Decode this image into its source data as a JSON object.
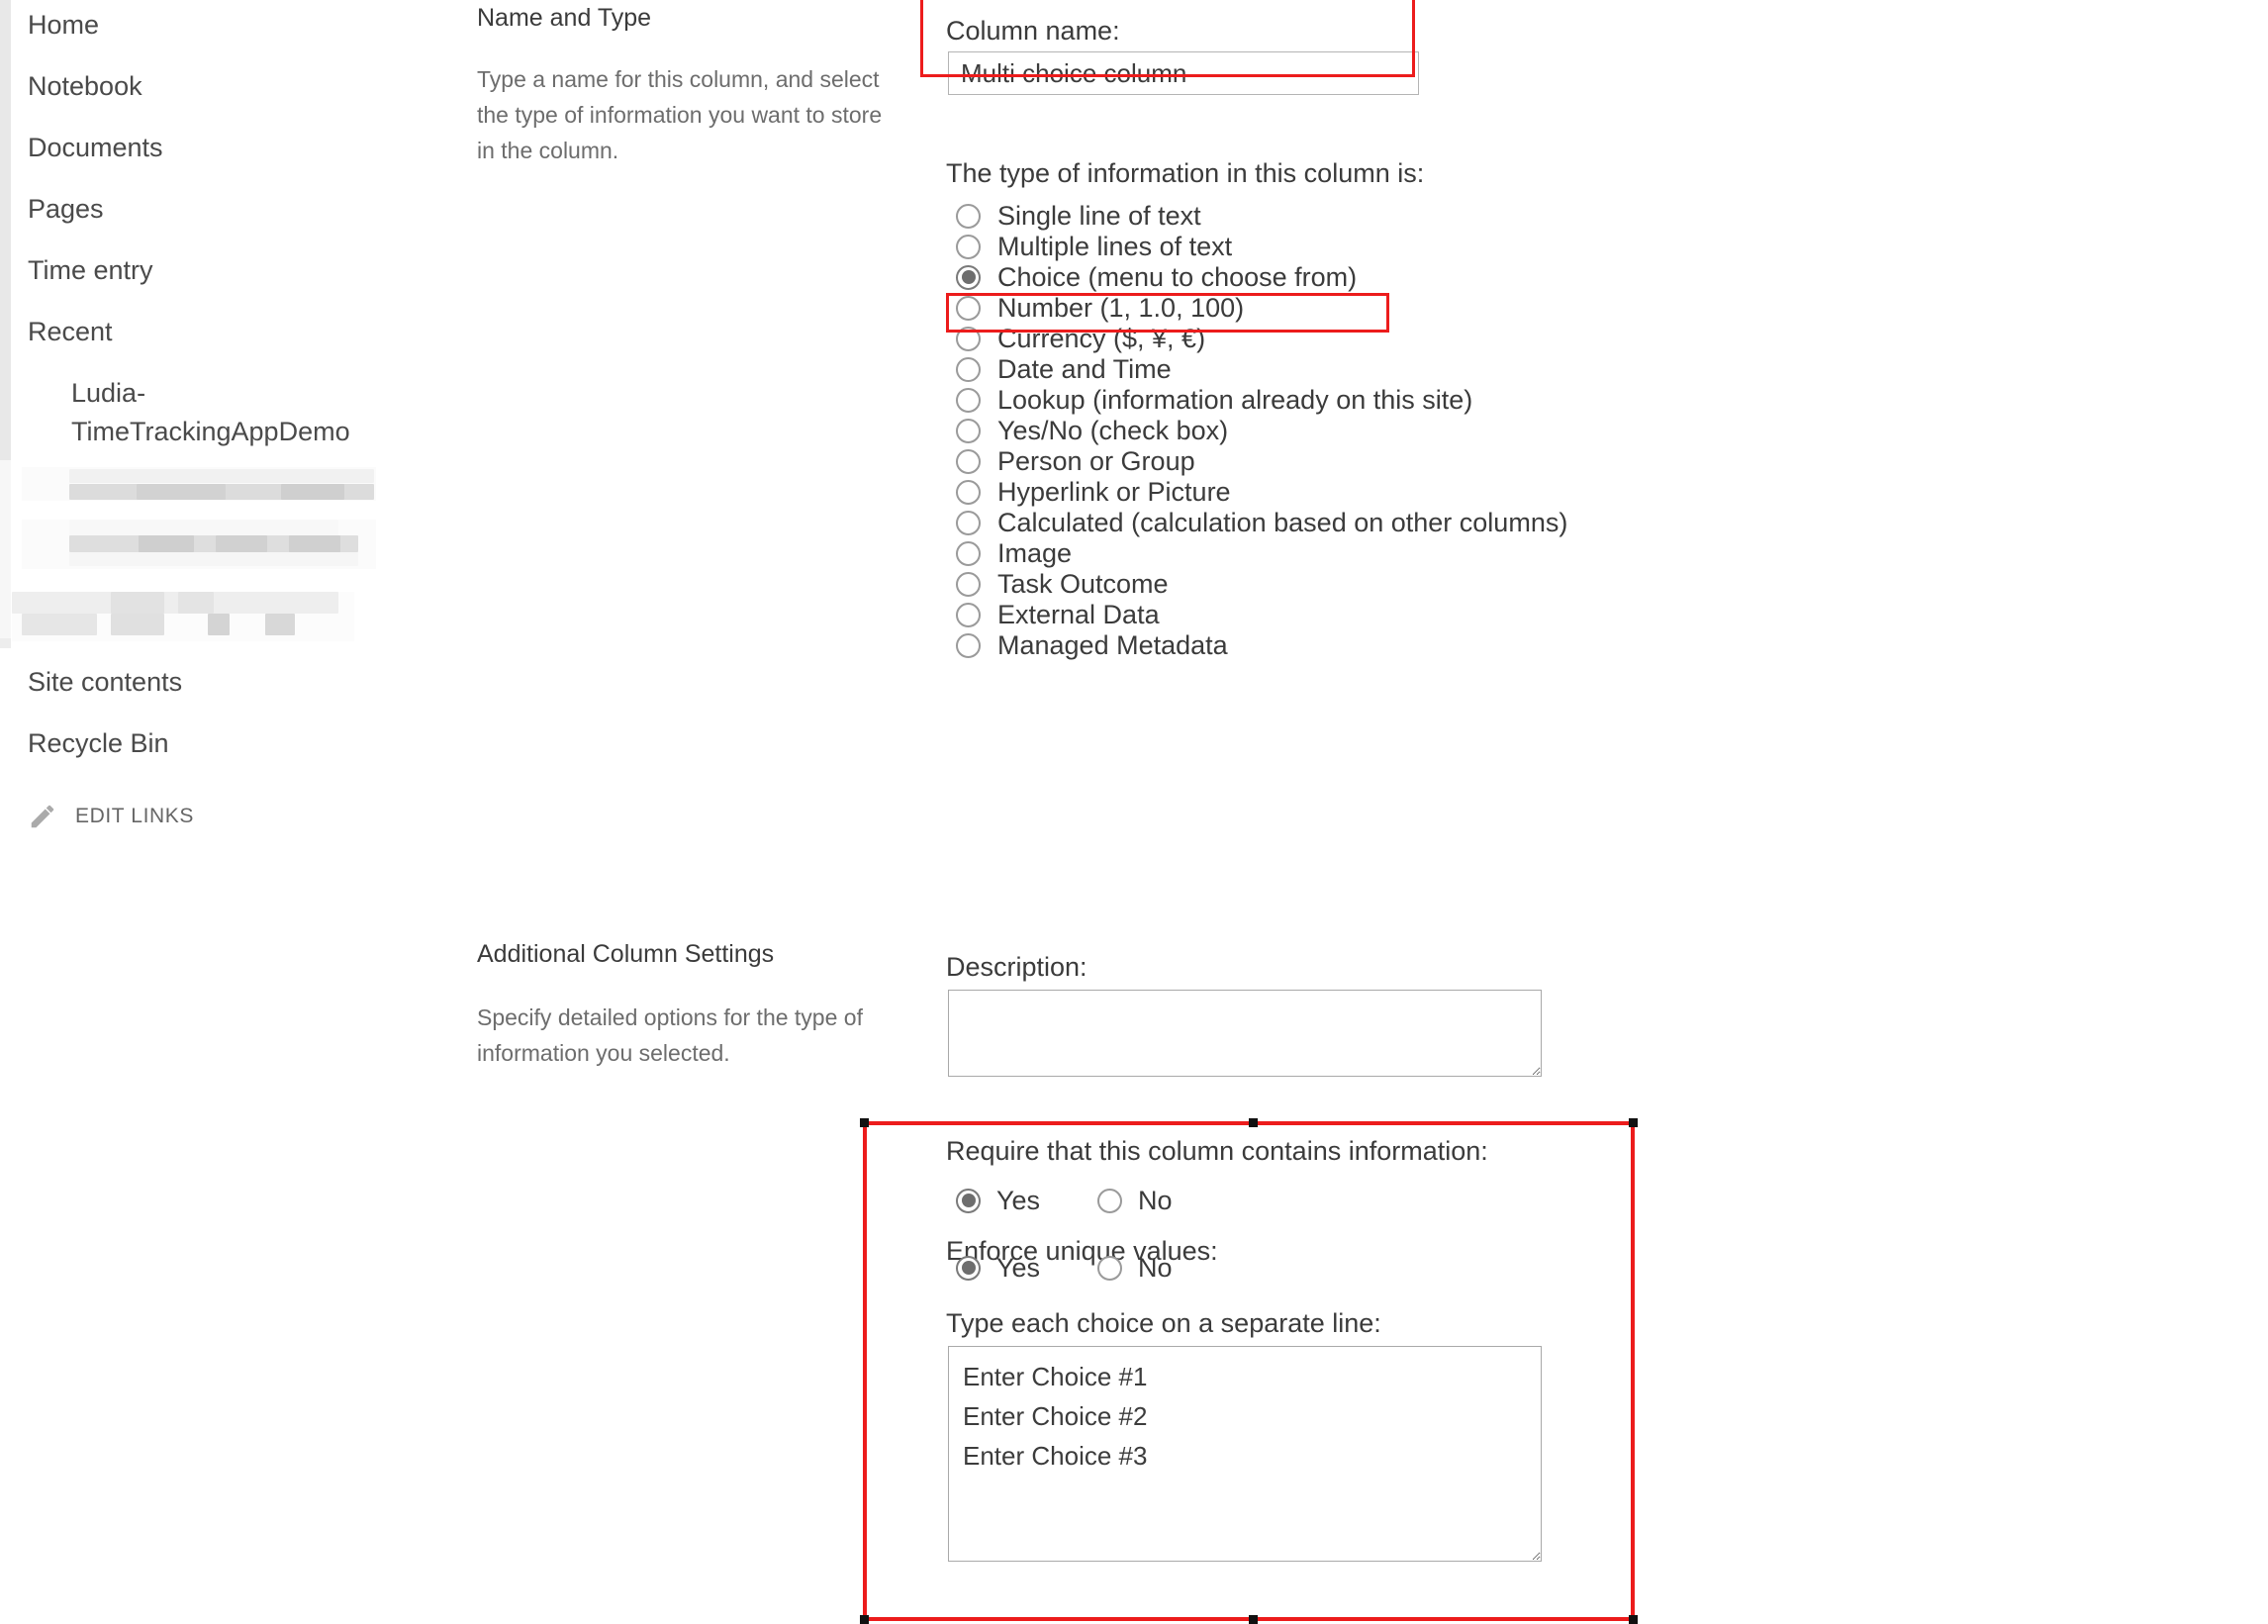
{
  "sidebar": {
    "items": [
      {
        "label": "Home",
        "name": "sidebar-item-home"
      },
      {
        "label": "Notebook",
        "name": "sidebar-item-notebook"
      },
      {
        "label": "Documents",
        "name": "sidebar-item-documents"
      },
      {
        "label": "Pages",
        "name": "sidebar-item-pages"
      },
      {
        "label": "Time entry",
        "name": "sidebar-item-time-entry"
      },
      {
        "label": "Recent",
        "name": "sidebar-item-recent"
      }
    ],
    "recent_child": "Ludia-TimeTrackingAppDemo",
    "site_contents": "Site contents",
    "recycle_bin": "Recycle Bin",
    "edit_links": "EDIT LINKS",
    "edit_links_icon": "pencil-icon"
  },
  "name_and_type": {
    "heading": "Name and Type",
    "description": "Type a name for this column, and select the type of information you want to store in the column.",
    "column_name_label": "Column name:",
    "column_name_value": "Multi choice column",
    "type_label": "The type of information in this column is:",
    "types": [
      {
        "label": "Single line of text",
        "selected": false
      },
      {
        "label": "Multiple lines of text",
        "selected": false
      },
      {
        "label": "Choice (menu to choose from)",
        "selected": true
      },
      {
        "label": "Number (1, 1.0, 100)",
        "selected": false
      },
      {
        "label": "Currency ($, ¥, €)",
        "selected": false
      },
      {
        "label": "Date and Time",
        "selected": false
      },
      {
        "label": "Lookup (information already on this site)",
        "selected": false
      },
      {
        "label": "Yes/No (check box)",
        "selected": false
      },
      {
        "label": "Person or Group",
        "selected": false
      },
      {
        "label": "Hyperlink or Picture",
        "selected": false
      },
      {
        "label": "Calculated (calculation based on other columns)",
        "selected": false
      },
      {
        "label": "Image",
        "selected": false
      },
      {
        "label": "Task Outcome",
        "selected": false
      },
      {
        "label": "External Data",
        "selected": false
      },
      {
        "label": "Managed Metadata",
        "selected": false
      }
    ]
  },
  "additional_settings": {
    "heading": "Additional Column Settings",
    "description": "Specify detailed options for the type of information you selected.",
    "description_label": "Description:",
    "description_value": "",
    "require_label": "Require that this column contains information:",
    "require_yes": "Yes",
    "require_no": "No",
    "require_selected": "Yes",
    "unique_label": "Enforce unique values:",
    "unique_yes": "Yes",
    "unique_no": "No",
    "unique_selected": "Yes",
    "choices_label": "Type each choice on a separate line:",
    "choices_value": "Enter Choice #1\nEnter Choice #2\nEnter Choice #3"
  },
  "annotations": {
    "accent_color": "#ec1c1c",
    "boxes": [
      {
        "name": "annotation-column-name"
      },
      {
        "name": "annotation-choice-type"
      },
      {
        "name": "annotation-choice-settings"
      }
    ]
  }
}
